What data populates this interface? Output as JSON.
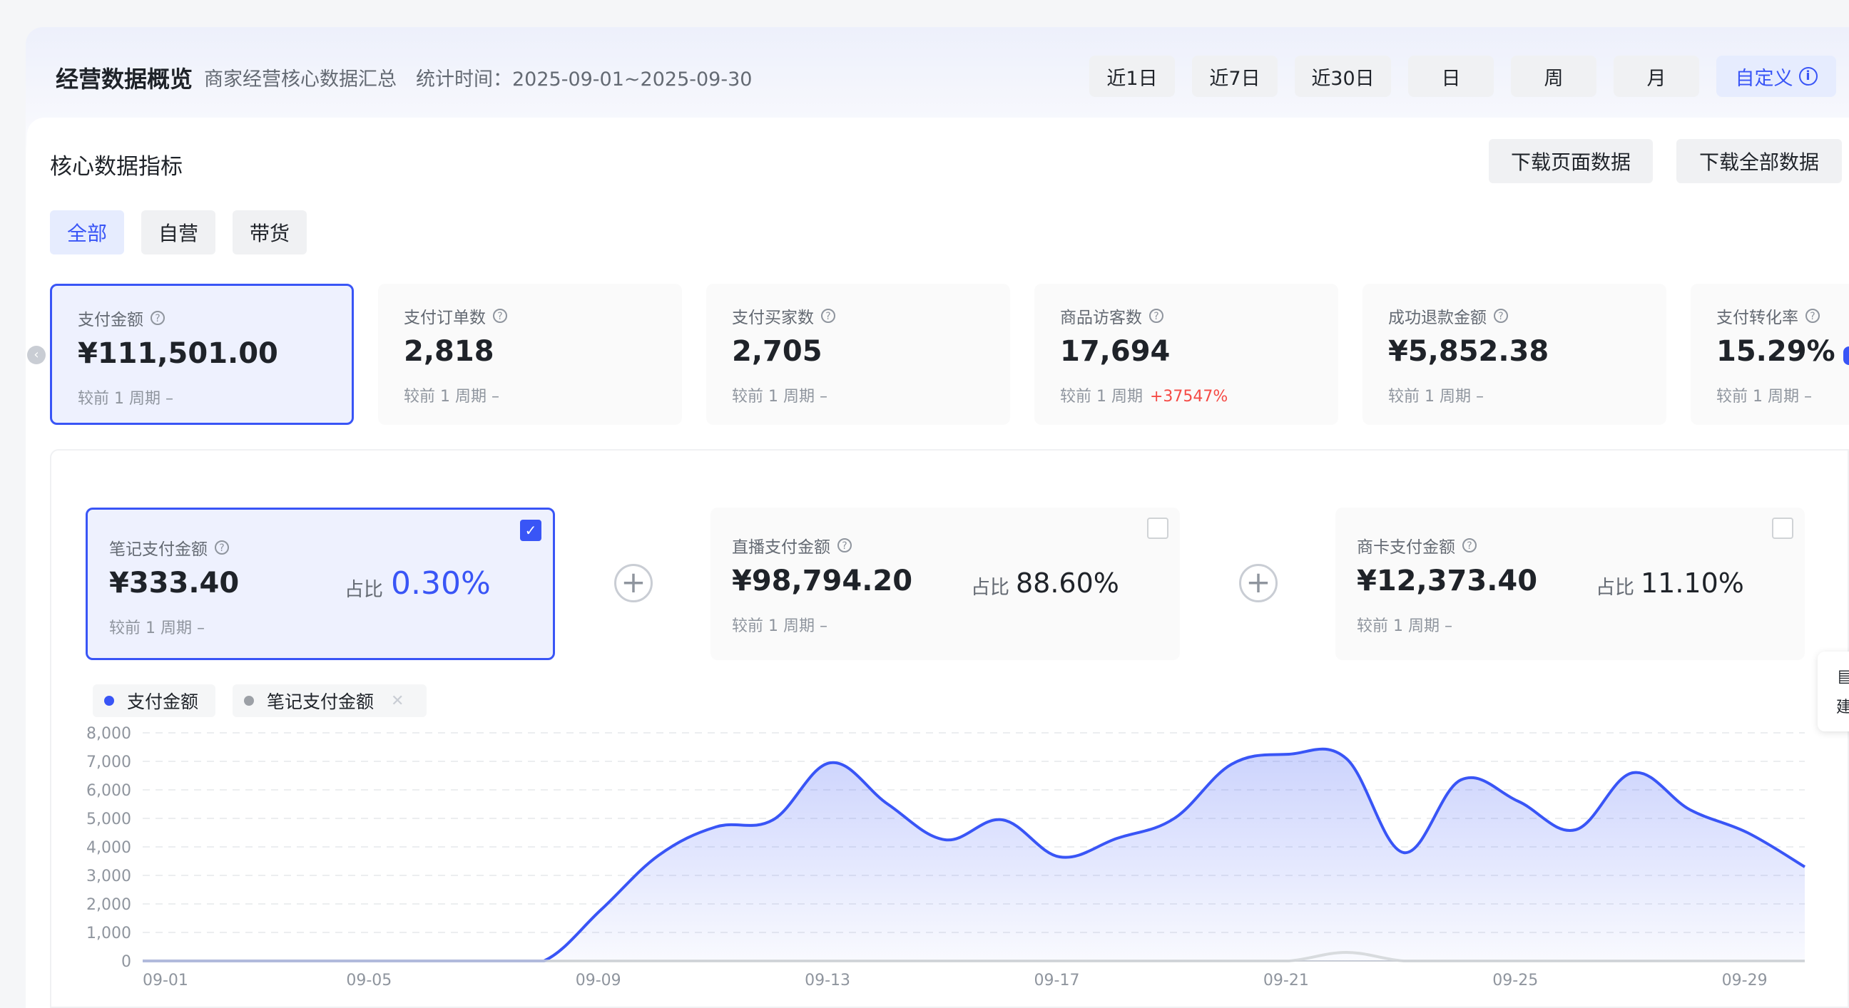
{
  "header": {
    "title": "经营数据概览",
    "subtitle": "商家经营核心数据汇总",
    "stat_time": "统计时间：2025-09-01~2025-09-30",
    "periods": [
      {
        "label": "近1日",
        "active": false
      },
      {
        "label": "近7日",
        "active": false
      },
      {
        "label": "近30日",
        "active": false
      },
      {
        "label": "日",
        "active": false
      },
      {
        "label": "周",
        "active": false
      },
      {
        "label": "月",
        "active": false
      },
      {
        "label": "自定义",
        "active": true
      }
    ]
  },
  "core": {
    "title": "核心数据指标",
    "download_page": "下载页面数据",
    "download_all": "下载全部数据",
    "segments": [
      {
        "label": "全部",
        "active": true
      },
      {
        "label": "自营",
        "active": false
      },
      {
        "label": "带货",
        "active": false
      }
    ],
    "metrics": [
      {
        "label": "支付金额",
        "value": "¥111,501.00",
        "compare": "较前 1 周期",
        "delta": "–",
        "delta_up": false,
        "active": true
      },
      {
        "label": "支付订单数",
        "value": "2,818",
        "compare": "较前 1 周期",
        "delta": "–",
        "delta_up": false,
        "active": false
      },
      {
        "label": "支付买家数",
        "value": "2,705",
        "compare": "较前 1 周期",
        "delta": "–",
        "delta_up": false,
        "active": false
      },
      {
        "label": "商品访客数",
        "value": "17,694",
        "compare": "较前 1 周期",
        "delta": "+37547%",
        "delta_up": true,
        "active": false
      },
      {
        "label": "成功退款金额",
        "value": "¥5,852.38",
        "compare": "较前 1 周期",
        "delta": "–",
        "delta_up": false,
        "active": false
      },
      {
        "label": "支付转化率",
        "value": "15.29%",
        "compare": "较前 1 周期",
        "delta": "–",
        "delta_up": false,
        "active": false
      }
    ]
  },
  "breakdown": {
    "share_label": "占比",
    "cards": [
      {
        "label": "笔记支付金额",
        "value": "¥333.40",
        "share": "0.30%",
        "compare": "较前 1 周期",
        "delta": "–",
        "checked": true
      },
      {
        "label": "直播支付金额",
        "value": "¥98,794.20",
        "share": "88.60%",
        "compare": "较前 1 周期",
        "delta": "–",
        "checked": false
      },
      {
        "label": "商卡支付金额",
        "value": "¥12,373.40",
        "share": "11.10%",
        "compare": "较前 1 周期",
        "delta": "–",
        "checked": false
      }
    ]
  },
  "legend": [
    {
      "label": "支付金额",
      "color": "#3955f6"
    },
    {
      "label": "笔记支付金额",
      "color": "#9ca0a6"
    }
  ],
  "side_tab": {
    "label": "建"
  },
  "colors": {
    "accent": "#3955f6",
    "up": "#f54a45"
  },
  "chart_data": {
    "type": "area",
    "x": [
      "09-01",
      "09-02",
      "09-03",
      "09-04",
      "09-05",
      "09-06",
      "09-07",
      "09-08",
      "09-09",
      "09-10",
      "09-11",
      "09-12",
      "09-13",
      "09-14",
      "09-15",
      "09-16",
      "09-17",
      "09-18",
      "09-19",
      "09-20",
      "09-21",
      "09-22",
      "09-23",
      "09-24",
      "09-25",
      "09-26",
      "09-27",
      "09-28",
      "09-29",
      "09-30"
    ],
    "x_tick_labels": [
      "09-01",
      "09-05",
      "09-09",
      "09-13",
      "09-17",
      "09-21",
      "09-25",
      "09-29"
    ],
    "ylim": [
      0,
      8000
    ],
    "y_ticks": [
      "0",
      "1,000",
      "2,000",
      "3,000",
      "4,000",
      "5,000",
      "6,000",
      "7,000",
      "8,000"
    ],
    "series": [
      {
        "name": "支付金额",
        "values": [
          0,
          0,
          0,
          0,
          0,
          0,
          0,
          0,
          1800,
          3700,
          4700,
          4950,
          6950,
          5500,
          4250,
          4950,
          3650,
          4300,
          5000,
          6900,
          7250,
          7100,
          3800,
          6350,
          5600,
          4600,
          6600,
          5300,
          4500,
          3300
        ]
      },
      {
        "name": "笔记支付金额",
        "values": [
          0,
          0,
          0,
          0,
          0,
          0,
          0,
          0,
          0,
          0,
          0,
          0,
          0,
          0,
          0,
          0,
          0,
          0,
          0,
          0,
          0,
          300,
          0,
          0,
          0,
          0,
          0,
          0,
          0,
          0
        ]
      }
    ]
  }
}
